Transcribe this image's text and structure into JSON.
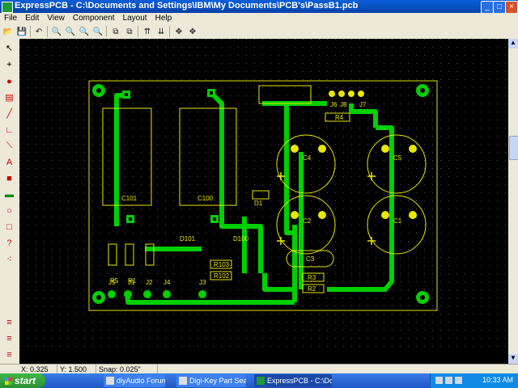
{
  "window": {
    "title": "ExpressPCB - C:\\Documents and Settings\\IBM\\My Documents\\PCB's\\PassB1.pcb"
  },
  "menu": [
    "File",
    "Edit",
    "View",
    "Component",
    "Layout",
    "Help"
  ],
  "canvas": {
    "components": [
      "C101",
      "C100",
      "C4",
      "C5",
      "C2",
      "C1",
      "C3",
      "R4",
      "D1",
      "D101",
      "D100",
      "R101",
      "R100",
      "R102",
      "R103",
      "R5",
      "R1",
      "R3",
      "R2",
      "J5",
      "J4",
      "J3",
      "J2",
      "J1"
    ],
    "labels": {
      "C101": "C101",
      "C100": "C100",
      "C4": "C4",
      "C5": "C5",
      "C2": "C2",
      "C1": "C1",
      "C3": "C3",
      "R4": "R4",
      "D1": "D1",
      "D101": "D101",
      "D100": "D100",
      "R101": "R101",
      "R100": "R100",
      "R102": "R102",
      "R103": "R103",
      "R5": "R5",
      "R1": "R1",
      "R2": "R2",
      "R3": "R3",
      "J5": "J5",
      "J1": "J1",
      "J2": "J2",
      "J4": "J4",
      "J3": "J3",
      "J6": "J6",
      "J8": "J8",
      "J7": "J7"
    },
    "colors": {
      "board_outline": "#e0e000",
      "trace": "#00e000",
      "silkscreen": "#e8e800",
      "background": "#000000",
      "grid": "#5a5a5a"
    }
  },
  "status": {
    "x": "X: 0.325",
    "y": "Y: 1.500",
    "snap": "Snap: 0.025\""
  },
  "taskbar": {
    "start": "start",
    "tasks": [
      "diyAudio Forums - Re...",
      "Digi-Key Part Search ...",
      "ExpressPCB - C:\\Docu..."
    ],
    "clock": "10:33 AM"
  },
  "icons": {
    "toolbar": [
      "open-icon",
      "save-icon",
      "undo-icon",
      "zoom-in-icon",
      "zoom-out-icon",
      "zoom-area-icon",
      "zoom-fit-icon",
      "rotate-icon",
      "flip-icon",
      "align-top-icon",
      "align-bottom-icon",
      "move-icon",
      "pan-icon"
    ],
    "left": [
      "pointer-icon",
      "place-component-icon",
      "pad-icon",
      "square-pad-icon",
      "trace-icon",
      "corner-icon",
      "diagonal-icon",
      "text-icon",
      "filled-square-icon",
      "rect-icon",
      "circle-icon",
      "box-icon",
      "help-icon",
      "dots-icon"
    ]
  }
}
